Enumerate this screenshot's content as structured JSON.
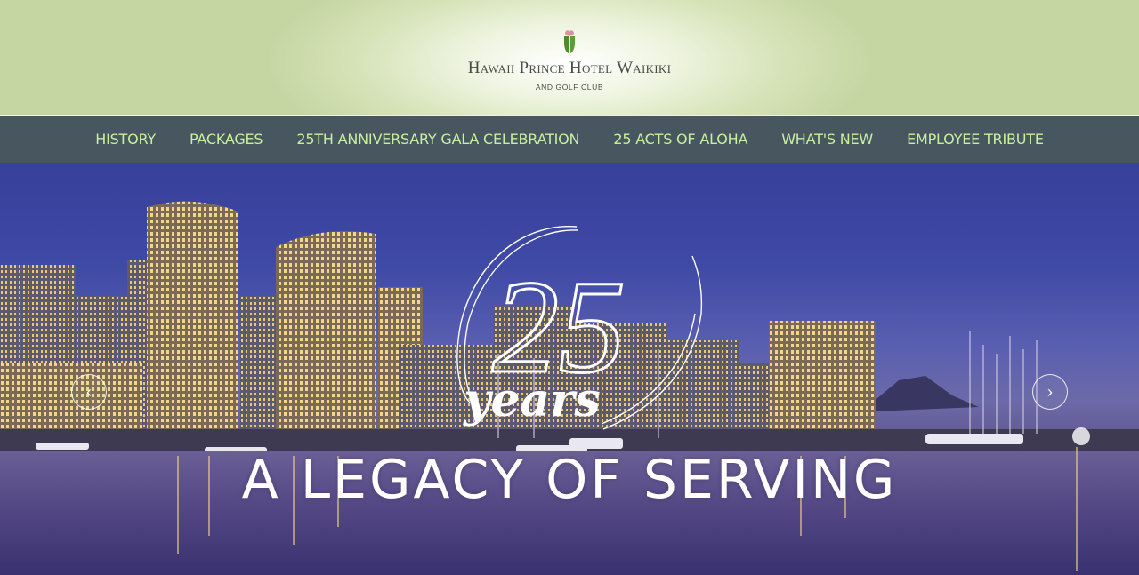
{
  "header": {
    "logo_name": "Hawaii Prince Hotel Waikiki",
    "logo_sub": "AND GOLF CLUB"
  },
  "nav": {
    "items": [
      "HISTORY",
      "PACKAGES",
      "25TH ANNIVERSARY GALA CELEBRATION",
      "25 ACTS OF ALOHA",
      "WHAT'S NEW",
      "EMPLOYEE TRIBUTE"
    ]
  },
  "hero": {
    "emblem_number": "25",
    "emblem_word": "years",
    "tagline": "A LEGACY OF SERVING",
    "prev_icon": "chevron-left-icon",
    "next_icon": "chevron-right-icon"
  },
  "colors": {
    "header_bg": "#c6d6a3",
    "nav_bg": "#485660",
    "nav_text": "#c8ef9e",
    "sky": "#37409b"
  }
}
